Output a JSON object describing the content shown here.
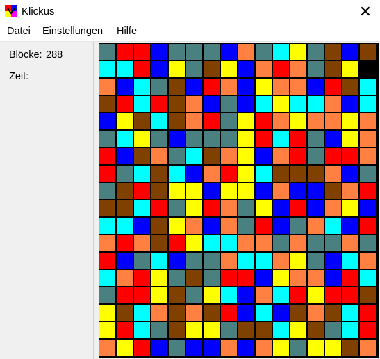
{
  "window": {
    "title": "Klickus",
    "close_glyph": "✕"
  },
  "menu": {
    "items": [
      "Datei",
      "Einstellungen",
      "Hilfe"
    ]
  },
  "status": {
    "blocks_label": "Blöcke:",
    "blocks_value": "288",
    "time_label": "Zeit:",
    "time_value": ""
  },
  "colors": {
    "T": "#4a8080",
    "R": "#ff0000",
    "B": "#0000ff",
    "C": "#00ffff",
    "Y": "#ffff00",
    "O": "#ff8040",
    "N": "#804000",
    "X": "#000000"
  },
  "board": {
    "columns": 17,
    "rows": [
      "TRRBTTTBOTCYTNBN",
      "CCRBYTNYBOROTNY",
      "OBCTNBROBYOOBRNC",
      "NRCRNOBTBCYCCOBC",
      "BYNCNORTYROYOOYO",
      "TCYTBTTTYRCRTBYO",
      "RBNOTCNOYBORTRRO",
      "RTCNCBORYCNNNOBT",
      "TNRNYYBYYBOBBNOR",
      "NNCRTYROTYBRBOYB",
      "CCBNYOBOTRBTOCBR",
      "ORONRYCCOOTOTTOT",
      "RBTCBTTOCCOYTBCO",
      "CORYTNTRRBYOOBRC",
      "TRRYNTYCBOCRYRRN",
      "YNCONONRBCBNONCR",
      "YRCTNYYTNNCYNTCR",
      "OYRBTBBOBOYTYYNO",
      "TTOTYBOYYNYNYCNC"
    ]
  }
}
